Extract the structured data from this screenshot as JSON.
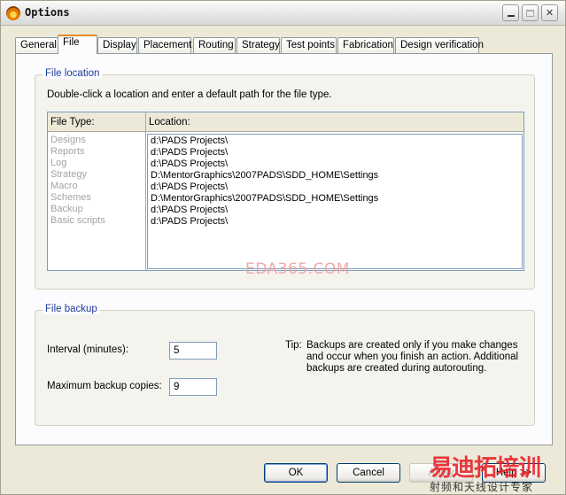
{
  "window": {
    "title": "Options",
    "minimize_label": "",
    "close_label": "✕"
  },
  "tabs": [
    {
      "label": "General"
    },
    {
      "label": "File"
    },
    {
      "label": "Display"
    },
    {
      "label": "Placement"
    },
    {
      "label": "Routing"
    },
    {
      "label": "Strategy"
    },
    {
      "label": "Test points"
    },
    {
      "label": "Fabrication"
    },
    {
      "label": "Design verification"
    }
  ],
  "active_tab": "File",
  "file_location": {
    "group_title": "File location",
    "hint": "Double-click a location and enter a default path for the file type.",
    "col_type": "File Type:",
    "col_location": "Location:",
    "rows": [
      {
        "type": "Designs",
        "location": "d:\\PADS Projects\\"
      },
      {
        "type": "Reports",
        "location": "d:\\PADS Projects\\"
      },
      {
        "type": "Log",
        "location": "d:\\PADS Projects\\"
      },
      {
        "type": "Strategy",
        "location": "D:\\MentorGraphics\\2007PADS\\SDD_HOME\\Settings"
      },
      {
        "type": "Macro",
        "location": "d:\\PADS Projects\\"
      },
      {
        "type": "Schemes",
        "location": "D:\\MentorGraphics\\2007PADS\\SDD_HOME\\Settings"
      },
      {
        "type": "Backup",
        "location": "d:\\PADS Projects\\"
      },
      {
        "type": "Basic scripts",
        "location": "d:\\PADS Projects\\"
      }
    ],
    "watermark": "EDA365.COM"
  },
  "file_backup": {
    "group_title": "File backup",
    "interval_label": "Interval (minutes):",
    "interval_value": "5",
    "max_copies_label": "Maximum backup copies:",
    "max_copies_value": "9",
    "tip_label": "Tip:",
    "tip_text": "Backups are created only if you make changes and occur when you finish an action. Additional backups are created during autorouting."
  },
  "buttons": {
    "ok": "OK",
    "cancel": "Cancel",
    "apply": "Apply",
    "help": "Help >>"
  },
  "brand_overlay": {
    "title": "易迪拓培训",
    "subtitle": "射频和天线设计专家"
  }
}
